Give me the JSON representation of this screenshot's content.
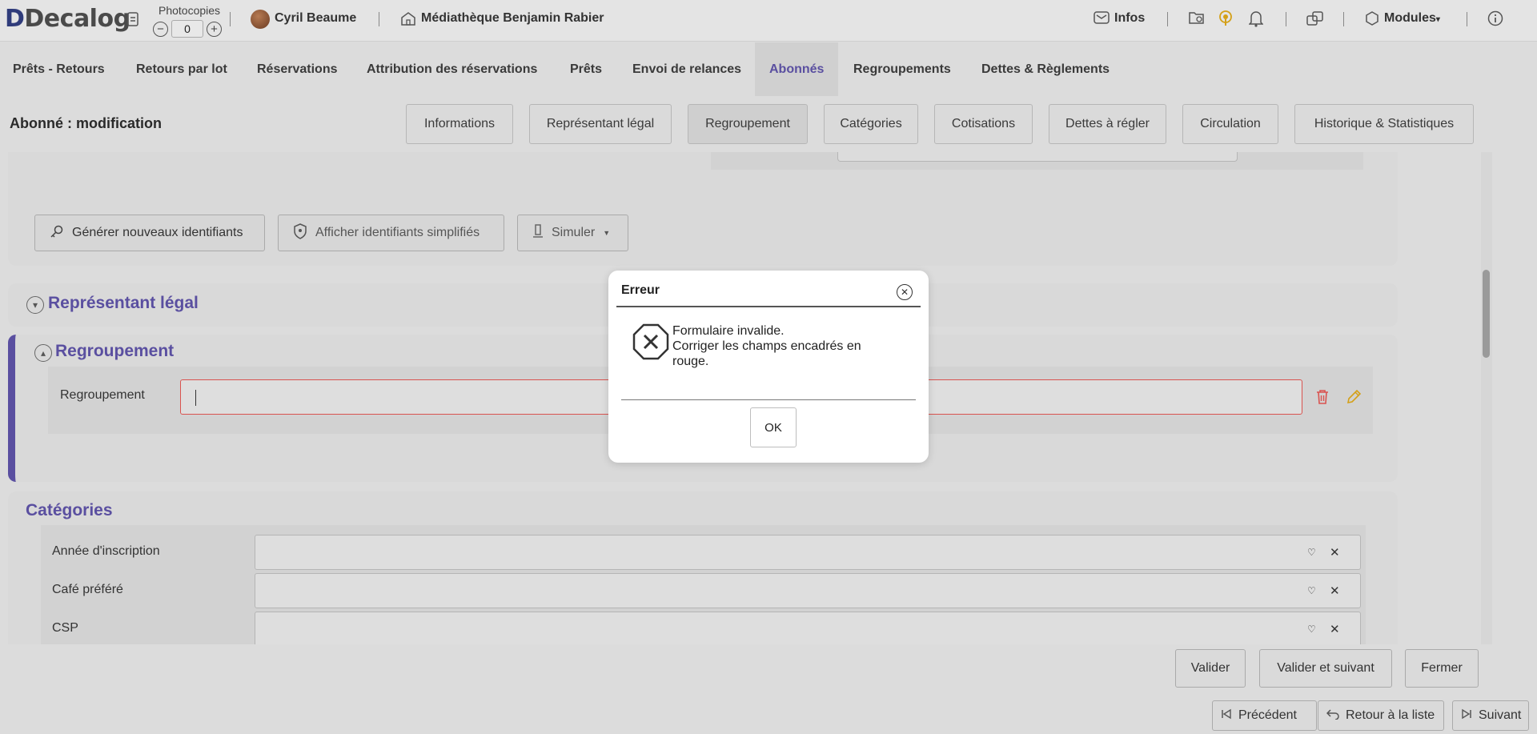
{
  "topbar": {
    "logo": "Decalog",
    "photocopies_label": "Photocopies",
    "photocopies_value": "0",
    "user_name": "Cyril Beaume",
    "library_name": "Médiathèque Benjamin Rabier",
    "infos_label": "Infos",
    "modules_label": "Modules"
  },
  "nav": {
    "items": [
      {
        "label": "Prêts - Retours"
      },
      {
        "label": "Retours par lot"
      },
      {
        "label": "Réservations"
      },
      {
        "label": "Attribution des réservations"
      },
      {
        "label": "Prêts"
      },
      {
        "label": "Envoi de relances"
      },
      {
        "label": "Abonnés"
      },
      {
        "label": "Regroupements"
      },
      {
        "label": "Dettes & Règlements"
      }
    ],
    "active": "Abonnés"
  },
  "subheader": {
    "title": "Abonné : modification",
    "tabs": [
      {
        "label": "Informations"
      },
      {
        "label": "Représentant légal"
      },
      {
        "label": "Regroupement"
      },
      {
        "label": "Catégories"
      },
      {
        "label": "Cotisations"
      },
      {
        "label": "Dettes à régler"
      },
      {
        "label": "Circulation"
      },
      {
        "label": "Historique & Statistiques"
      }
    ],
    "active_tab": "Regroupement"
  },
  "identifiants": {
    "generate_label": "Générer nouveaux identifiants",
    "show_simplified_label": "Afficher identifiants simplifiés",
    "simulate_label": "Simuler"
  },
  "sections": {
    "representant": {
      "title": "Représentant légal"
    },
    "regroupement": {
      "title": "Regroupement",
      "field_label": "Regroupement",
      "field_value": ""
    },
    "categories": {
      "title": "Catégories",
      "fields": [
        {
          "label": "Année d'inscription",
          "value": ""
        },
        {
          "label": "Café préféré",
          "value": ""
        },
        {
          "label": "CSP",
          "value": ""
        }
      ]
    }
  },
  "footer": {
    "valider": "Valider",
    "valider_suivant": "Valider et suivant",
    "fermer": "Fermer",
    "precedent": "Précédent",
    "retour_liste": "Retour à la liste",
    "suivant": "Suivant"
  },
  "modal": {
    "title": "Erreur",
    "message": "Formulaire invalide.\nCorriger les champs encadrés en rouge.",
    "ok": "OK"
  },
  "colors": {
    "accent": "#5a4fa0",
    "error": "#d9534f",
    "icon_orange": "#d4a017"
  }
}
